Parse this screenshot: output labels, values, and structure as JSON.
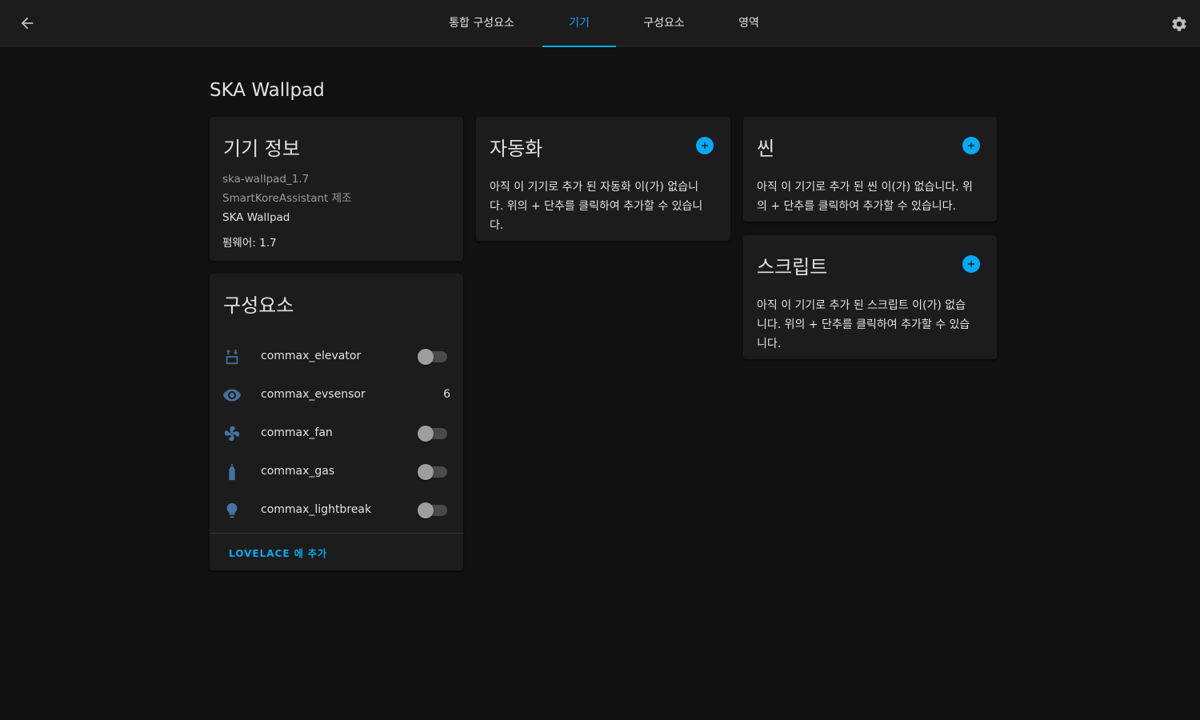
{
  "header": {
    "tabs": [
      {
        "label": "통합 구성요소",
        "active": false
      },
      {
        "label": "기기",
        "active": true
      },
      {
        "label": "구성요소",
        "active": false
      },
      {
        "label": "영역",
        "active": false
      }
    ],
    "back_icon": "arrow-left-icon",
    "settings_icon": "gear-icon"
  },
  "page": {
    "title": "SKA Wallpad"
  },
  "device_info": {
    "title": "기기 정보",
    "model": "ska-wallpad_1.7",
    "manufacturer": "SmartKoreAssistant 제조",
    "name": "SKA Wallpad",
    "firmware": "펌웨어: 1.7"
  },
  "entities": {
    "title": "구성요소",
    "items": [
      {
        "name": "commax_elevator",
        "icon": "elevator-icon",
        "control": "toggle",
        "state": "off"
      },
      {
        "name": "commax_evsensor",
        "icon": "eye-icon",
        "control": "value",
        "state": "6"
      },
      {
        "name": "commax_fan",
        "icon": "fan-icon",
        "control": "toggle",
        "state": "off"
      },
      {
        "name": "commax_gas",
        "icon": "gas-cylinder-icon",
        "control": "toggle",
        "state": "off"
      },
      {
        "name": "commax_lightbreak",
        "icon": "lightbulb-icon",
        "control": "toggle",
        "state": "off"
      }
    ],
    "action_label": "LOVELACE 에 추가"
  },
  "automation": {
    "title": "자동화",
    "line1": "아직 이 기기로 추가 된 자동화 이(가) 없습니",
    "line2": "다. 위의 + 단추를 클릭하여 추가할 수 있습니",
    "line3": "다."
  },
  "scene": {
    "title": "씬",
    "line1": "아직 이 기기로 추가 된 씬 이(가) 없습니다. 위",
    "line2": "의 + 단추를 클릭하여 추가할 수 있습니다."
  },
  "script": {
    "title": "스크립트",
    "line1": "아직 이 기기로 추가 된 스크립트 이(가) 없습",
    "line2": "니다. 위의 + 단추를 클릭하여 추가할 수 있습",
    "line3": "니다."
  },
  "colors": {
    "accent": "#03a9f4",
    "icon": "#44739e",
    "background": "#111111",
    "card": "#1c1c1c"
  }
}
